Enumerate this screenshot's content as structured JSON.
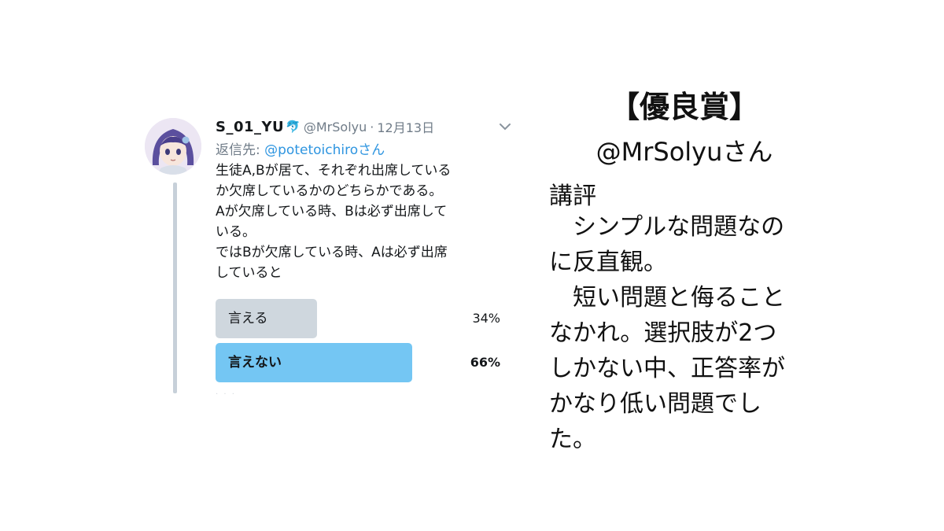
{
  "tweet": {
    "display_name": "S_01_YU",
    "name_emoji": "🐬",
    "handle": "@MrSolyu",
    "separator": "·",
    "date": "12月13日",
    "reply_prefix": "返信先: ",
    "reply_mention": "@potetoichiro",
    "reply_suffix": "さん",
    "body": "生徒A,Bが居て、それぞれ出席している\nか欠席しているかのどちらかである。\nAが欠席している時、Bは必ず出席して\nいる。\nではBが欠席している時、Aは必ず出席\nしていると",
    "poll": {
      "options": [
        {
          "label": "言える",
          "percent_text": "34%",
          "value": 0.34
        },
        {
          "label": "言えない",
          "percent_text": "66%",
          "value": 0.66
        }
      ]
    },
    "colors": {
      "winner_bar": "#74c6f3",
      "other_bar": "#cfd7de",
      "mention": "#2e95e0",
      "muted": "#707c88"
    }
  },
  "award": {
    "title": "【優良賞】",
    "winner": "@MrSolyuさん",
    "review_heading": "講評",
    "review_text": "　シンプルな問題なの\nに反直観。\n　短い問題と侮ること\nなかれ。選択肢が2つ\nしかない中、正答率が\nかなり低い問題でし\nた。"
  }
}
